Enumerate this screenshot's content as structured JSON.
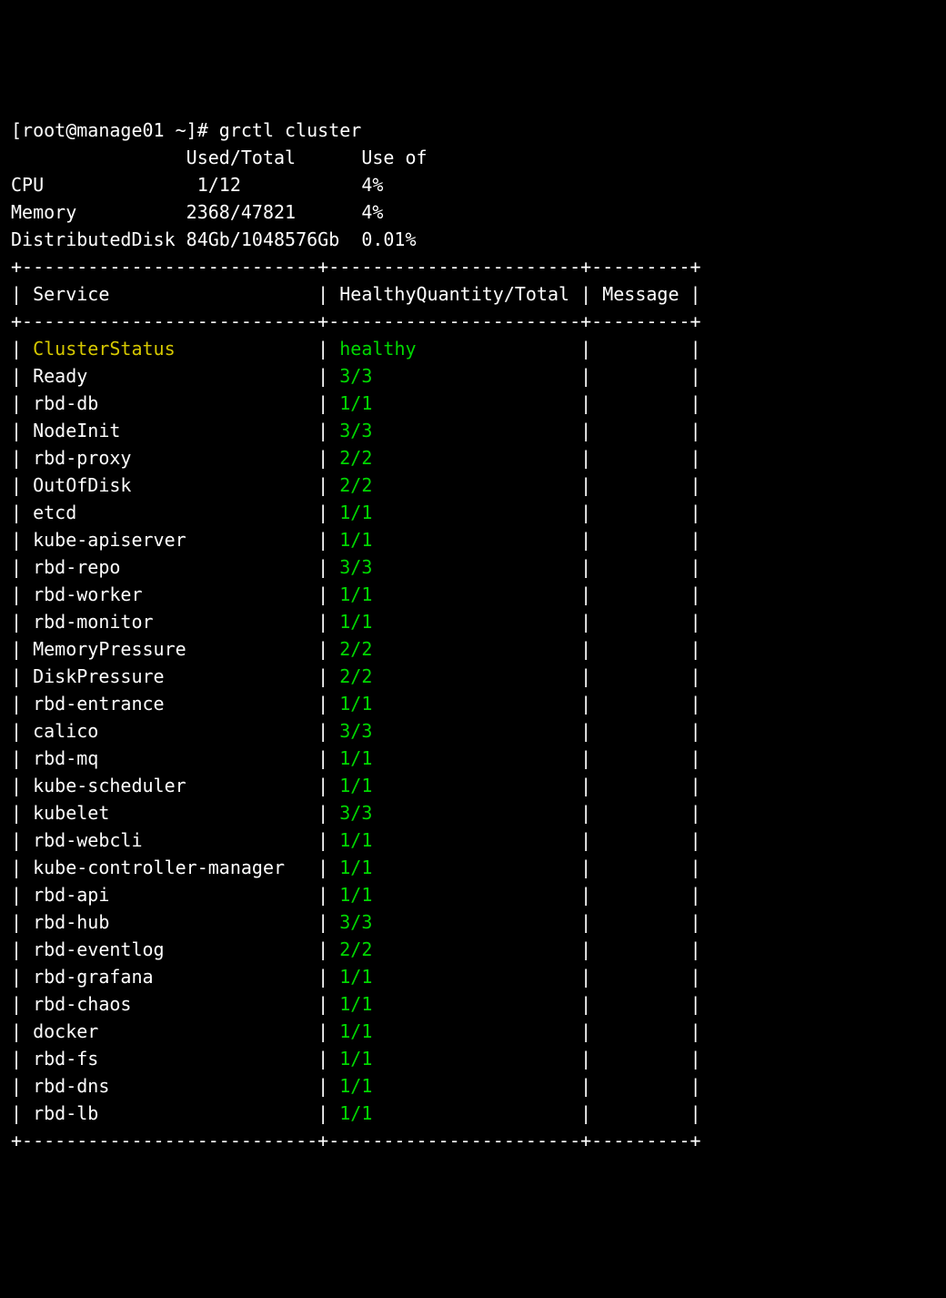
{
  "prompt": "[root@manage01 ~]#",
  "command": "grctl cluster",
  "resource_header": {
    "used_total": "Used/Total",
    "use_of": "Use of"
  },
  "resources": [
    {
      "label": "CPU",
      "used_total": " 1/12",
      "use_of": "4%"
    },
    {
      "label": "Memory",
      "used_total": "2368/47821",
      "use_of": "4%"
    },
    {
      "label": "DistributedDisk",
      "used_total": "84Gb/1048576Gb",
      "use_of": "0.01%"
    }
  ],
  "table_headers": {
    "service": "Service",
    "health": "HealthyQuantity/Total",
    "message": "Message"
  },
  "rows": [
    {
      "service": "ClusterStatus",
      "health": "healthy",
      "message": "",
      "highlight": true
    },
    {
      "service": "Ready",
      "health": "3/3",
      "message": ""
    },
    {
      "service": "rbd-db",
      "health": "1/1",
      "message": ""
    },
    {
      "service": "NodeInit",
      "health": "3/3",
      "message": ""
    },
    {
      "service": "rbd-proxy",
      "health": "2/2",
      "message": ""
    },
    {
      "service": "OutOfDisk",
      "health": "2/2",
      "message": ""
    },
    {
      "service": "etcd",
      "health": "1/1",
      "message": ""
    },
    {
      "service": "kube-apiserver",
      "health": "1/1",
      "message": ""
    },
    {
      "service": "rbd-repo",
      "health": "3/3",
      "message": ""
    },
    {
      "service": "rbd-worker",
      "health": "1/1",
      "message": ""
    },
    {
      "service": "rbd-monitor",
      "health": "1/1",
      "message": ""
    },
    {
      "service": "MemoryPressure",
      "health": "2/2",
      "message": ""
    },
    {
      "service": "DiskPressure",
      "health": "2/2",
      "message": ""
    },
    {
      "service": "rbd-entrance",
      "health": "1/1",
      "message": ""
    },
    {
      "service": "calico",
      "health": "3/3",
      "message": ""
    },
    {
      "service": "rbd-mq",
      "health": "1/1",
      "message": ""
    },
    {
      "service": "kube-scheduler",
      "health": "1/1",
      "message": ""
    },
    {
      "service": "kubelet",
      "health": "3/3",
      "message": ""
    },
    {
      "service": "rbd-webcli",
      "health": "1/1",
      "message": ""
    },
    {
      "service": "kube-controller-manager",
      "health": "1/1",
      "message": ""
    },
    {
      "service": "rbd-api",
      "health": "1/1",
      "message": ""
    },
    {
      "service": "rbd-hub",
      "health": "3/3",
      "message": ""
    },
    {
      "service": "rbd-eventlog",
      "health": "2/2",
      "message": ""
    },
    {
      "service": "rbd-grafana",
      "health": "1/1",
      "message": ""
    },
    {
      "service": "rbd-chaos",
      "health": "1/1",
      "message": ""
    },
    {
      "service": "docker",
      "health": "1/1",
      "message": ""
    },
    {
      "service": "rbd-fs",
      "health": "1/1",
      "message": ""
    },
    {
      "service": "rbd-dns",
      "health": "1/1",
      "message": ""
    },
    {
      "service": "rbd-lb",
      "health": "1/1",
      "message": ""
    }
  ],
  "col_widths": {
    "service": 25,
    "health": 23,
    "message": 9
  }
}
